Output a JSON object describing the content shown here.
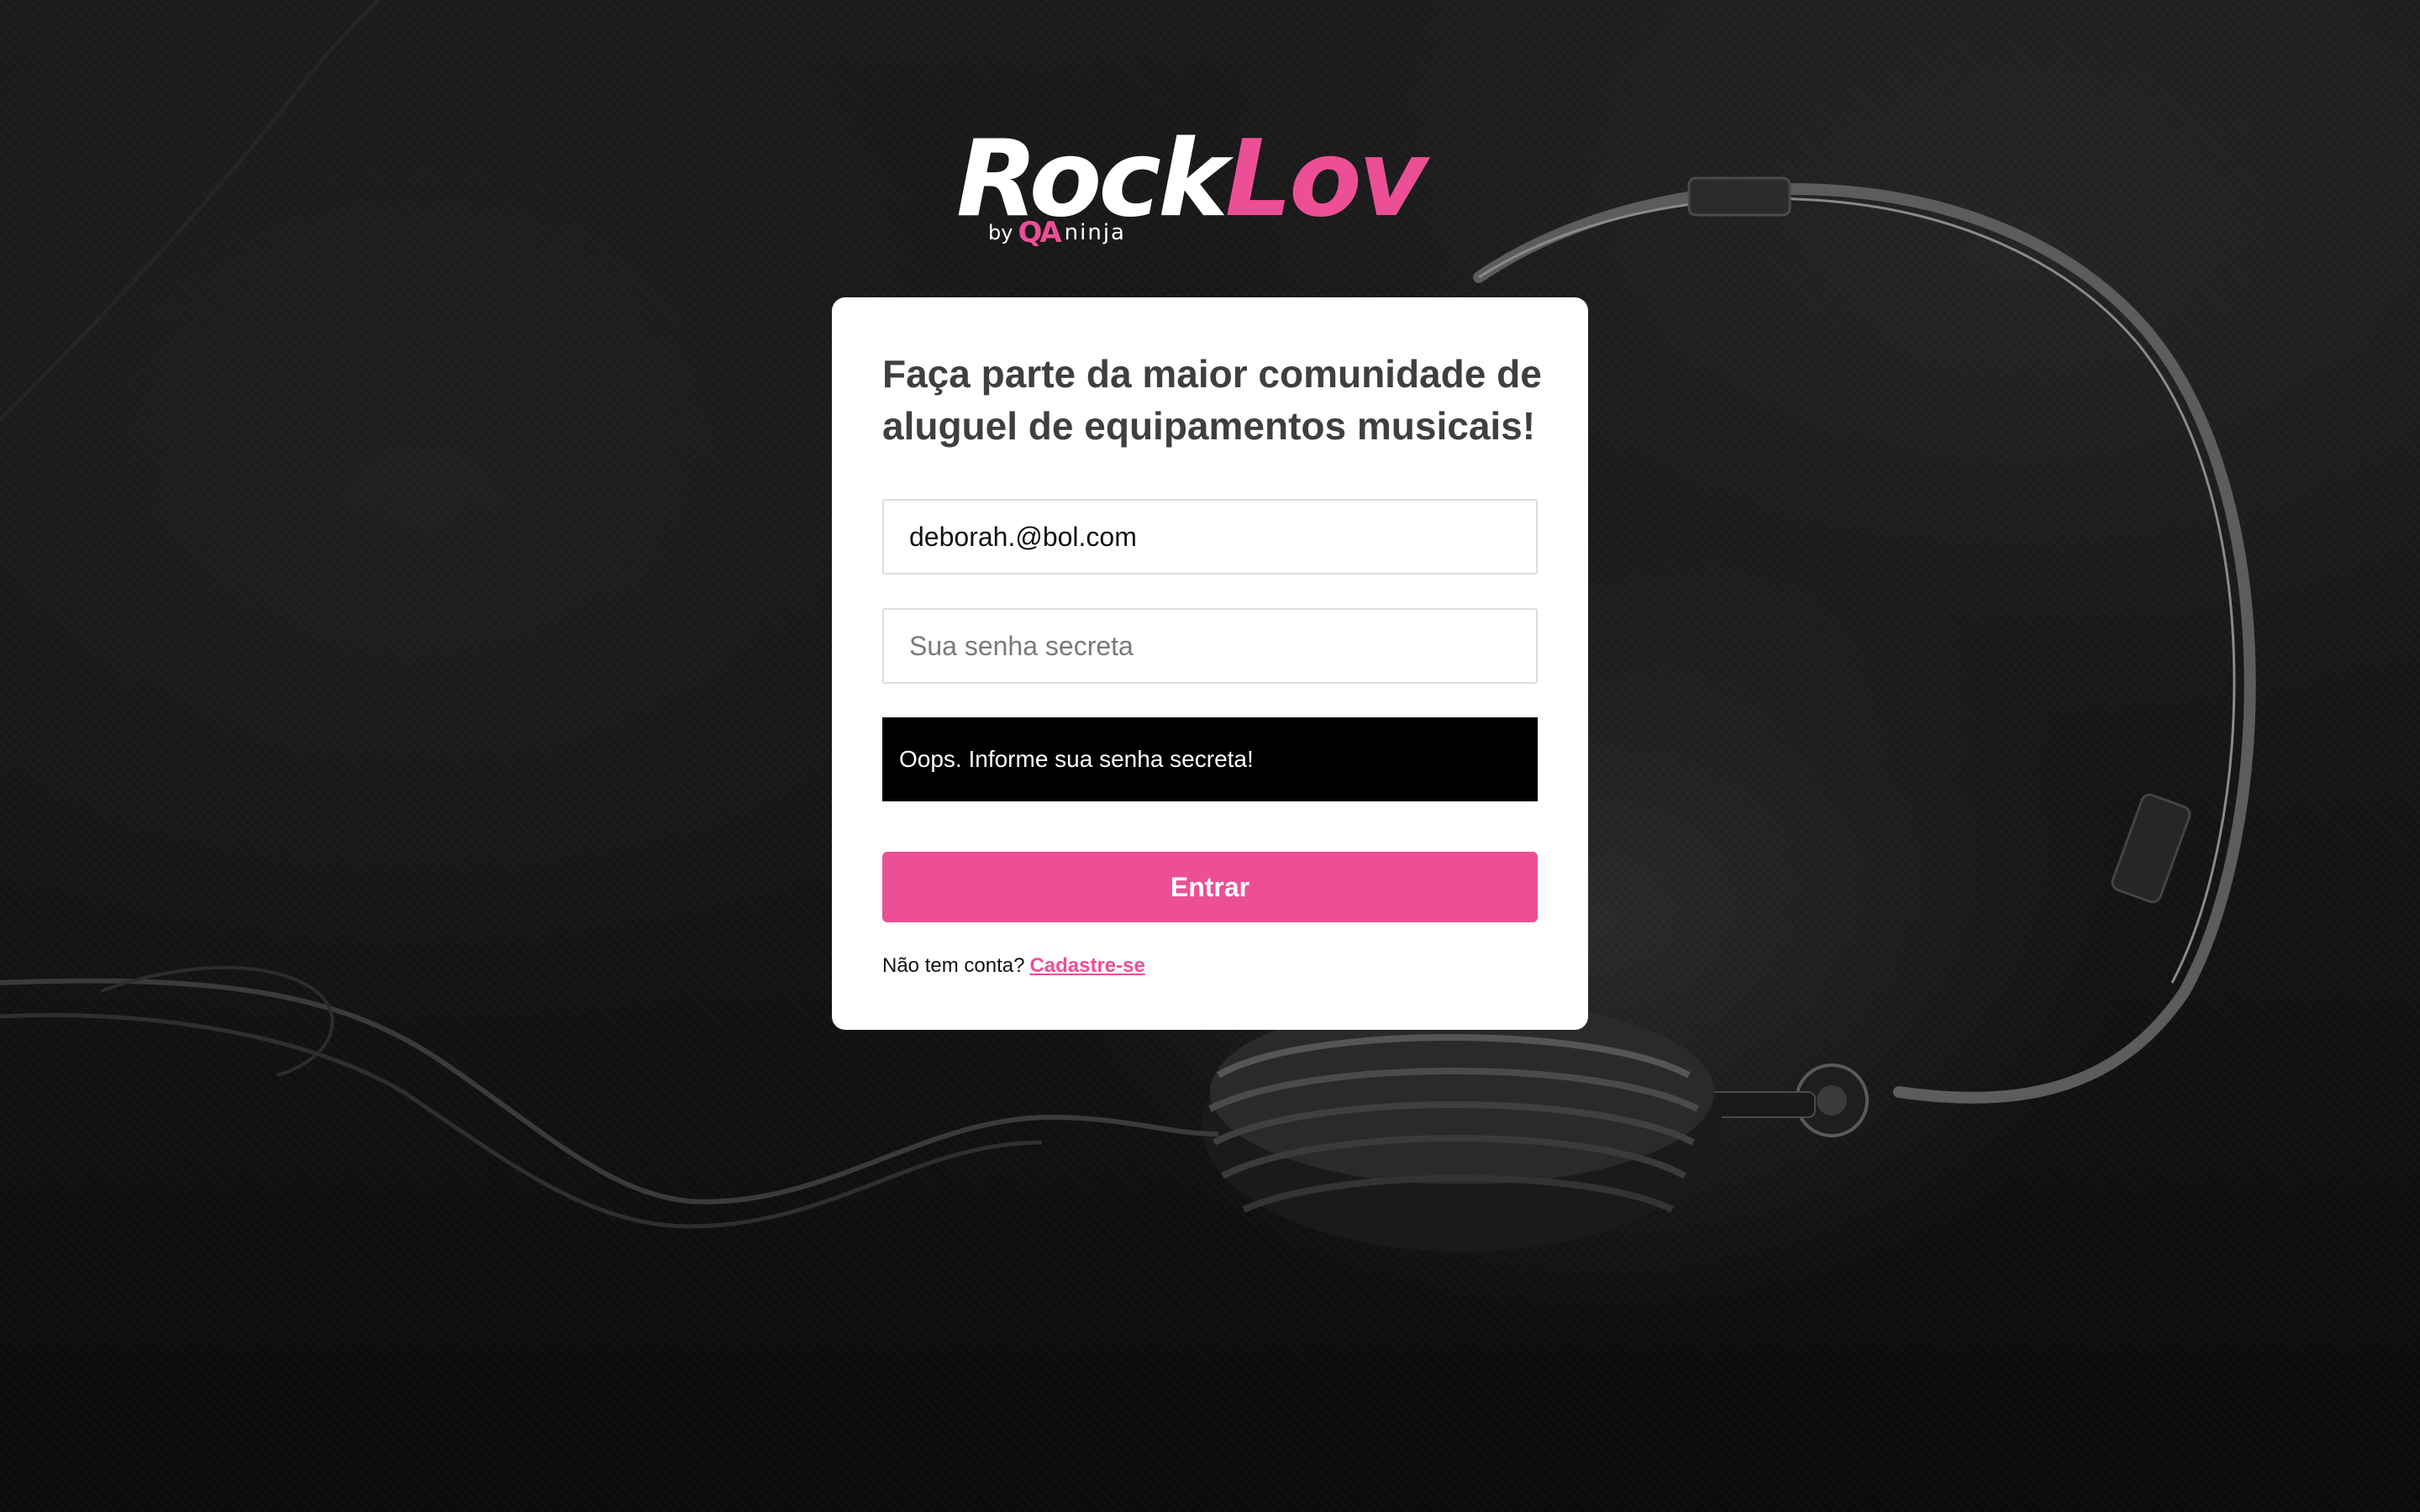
{
  "brand": {
    "name_part1": "Rock",
    "name_part2": "Lov",
    "by": "by",
    "qa_mark": "QA",
    "ninja": "ninja",
    "accent_color": "#ec4f96"
  },
  "login": {
    "title": "Faça parte da maior comunidade de aluguel de equipamentos musicais!",
    "email_value": "deborah.@bol.com",
    "password_value": "",
    "password_placeholder": "Sua senha secreta",
    "alert_message": "Oops. Informe sua senha secreta!",
    "submit_label": "Entrar",
    "signup_prompt": "Não tem conta?",
    "signup_link": "Cadastre-se"
  },
  "colors": {
    "card_background": "#ffffff",
    "alert_background": "#000000",
    "button_background": "#ec4f96",
    "title_color": "#3f3f3f",
    "page_background": "#151515"
  },
  "icons": {
    "background_image": "headphones-background"
  }
}
